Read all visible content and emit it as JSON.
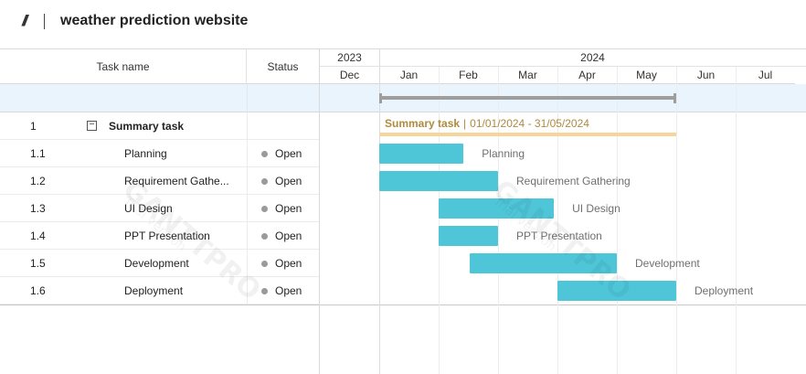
{
  "header": {
    "title": "weather prediction website",
    "icon": "double-slash-icon"
  },
  "table": {
    "columns": {
      "name": "Task name",
      "status": "Status"
    },
    "rows": [
      {
        "num": "1",
        "name": "Summary task",
        "status": "",
        "summary": true
      },
      {
        "num": "1.1",
        "name": "Planning",
        "status": "Open"
      },
      {
        "num": "1.2",
        "name": "Requirement Gathe...",
        "status": "Open"
      },
      {
        "num": "1.3",
        "name": "UI Design",
        "status": "Open"
      },
      {
        "num": "1.4",
        "name": "PPT Presentation",
        "status": "Open"
      },
      {
        "num": "1.5",
        "name": "Development",
        "status": "Open"
      },
      {
        "num": "1.6",
        "name": "Deployment",
        "status": "Open"
      }
    ],
    "collapse_symbol": "−",
    "status_dot_color": "#9a9a9a"
  },
  "timeline": {
    "years": [
      {
        "label": "2023"
      },
      {
        "label": "2024"
      }
    ],
    "months": [
      "Dec",
      "Jan",
      "Feb",
      "Mar",
      "Apr",
      "May",
      "Jun",
      "Jul"
    ],
    "summary": {
      "name": "Summary task",
      "dates": "01/01/2024 - 31/05/2024",
      "start_month": 1.0,
      "end_month": 6.0
    },
    "tasks": [
      {
        "name": "Planning",
        "start_month": 1.0,
        "end_month": 2.42
      },
      {
        "name": "Requirement Gathering",
        "start_month": 1.0,
        "end_month": 3.0
      },
      {
        "name": "UI Design",
        "start_month": 2.0,
        "end_month": 3.94
      },
      {
        "name": "PPT Presentation",
        "start_month": 2.0,
        "end_month": 3.0
      },
      {
        "name": "Development",
        "start_month": 2.52,
        "end_month": 5.0
      },
      {
        "name": "Deployment",
        "start_month": 4.0,
        "end_month": 6.0
      }
    ],
    "colors": {
      "task": "#4fc6d8",
      "summary_line": "#f7d59a",
      "summary_text": "#b08a3e",
      "project_bar": "#9e9e9e",
      "band": "#e9f4fc"
    }
  },
  "watermark": {
    "brand": "GANTTPRO",
    "sub": "Trial version"
  }
}
